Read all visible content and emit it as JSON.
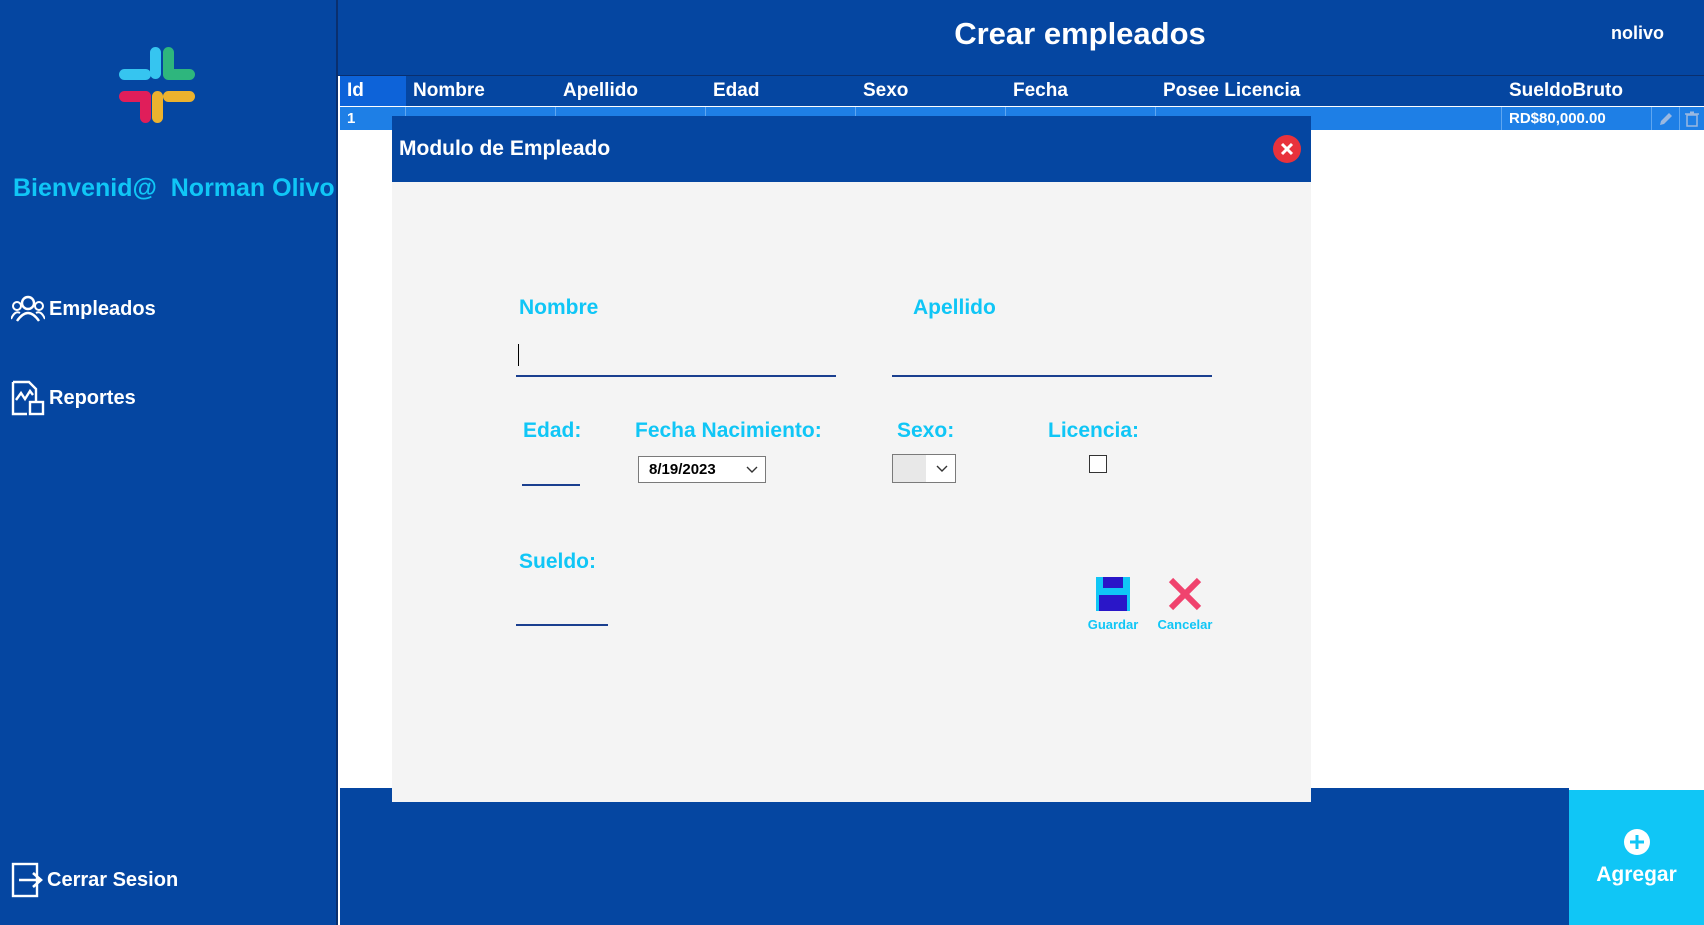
{
  "sidebar": {
    "welcome": "Bienvenid@  Norman Olivo",
    "items": [
      {
        "label": "Empleados",
        "icon": "users-icon"
      },
      {
        "label": "Reportes",
        "icon": "report-icon"
      }
    ],
    "logout_label": "Cerrar Sesion",
    "logo": "slack-logo"
  },
  "header": {
    "title": "Crear empleados",
    "username": "nolivo"
  },
  "grid": {
    "columns": [
      "Id",
      "Nombre",
      "Apellido",
      "Edad",
      "Sexo",
      "Fecha",
      "Posee Licencia",
      "SueldoBruto"
    ],
    "rows": [
      {
        "id": "1",
        "nombre": "",
        "apellido": "",
        "edad": "",
        "sexo": "",
        "fecha": "",
        "licencia": "",
        "sueldo": "RD$80,000.00"
      }
    ]
  },
  "modal": {
    "title": "Modulo de Empleado",
    "fields": {
      "nombre": {
        "label": "Nombre",
        "value": ""
      },
      "apellido": {
        "label": "Apellido",
        "value": ""
      },
      "edad": {
        "label": "Edad:",
        "value": ""
      },
      "fecha_nacimiento": {
        "label": "Fecha Nacimiento:",
        "value": "8/19/2023"
      },
      "sexo": {
        "label": "Sexo:",
        "value": ""
      },
      "licencia": {
        "label": "Licencia:",
        "checked": false
      },
      "sueldo": {
        "label": "Sueldo:",
        "value": ""
      }
    },
    "save_label": "Guardar",
    "cancel_label": "Cancelar"
  },
  "add_button_label": "Agregar",
  "colors": {
    "primary": "#0546a1",
    "accent": "#10c6f6",
    "row_selected": "#1e7fe6",
    "close_red": "#e8323c",
    "cancel_red": "#f0436e"
  }
}
